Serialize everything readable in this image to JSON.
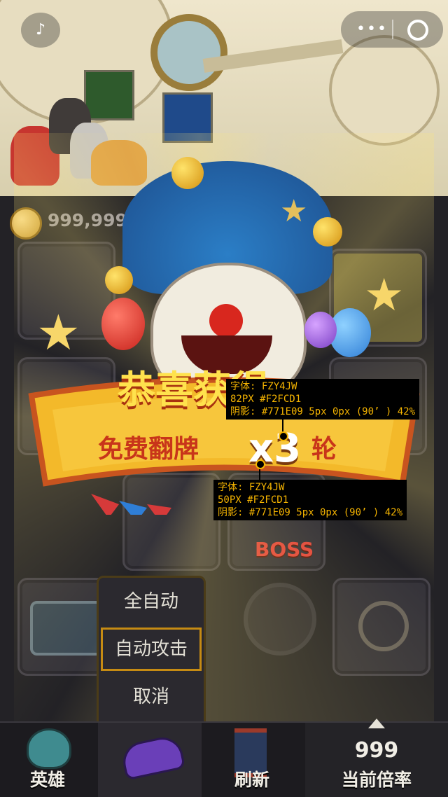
{
  "top_bar": {
    "mute_icon": "speaker-mute-icon",
    "menu_icon": "more-icon",
    "close_icon": "target-icon"
  },
  "hud": {
    "coins": "999,999,999"
  },
  "banner": {
    "title": "恭喜获得",
    "subtitle": "免费翻牌",
    "multiplier": "x3",
    "unit": "轮"
  },
  "annotations": {
    "a1": [
      "字体: FZY4JW",
      "82PX #F2FCD1",
      "阴影: #771E09 5px 0px (90’ ) 42%"
    ],
    "a2": [
      "字体: FZY4JW",
      "50PX #F2FCD1",
      "阴影: #771E09 5px 0px (90’ ) 42%"
    ]
  },
  "tiles": {
    "boss_label": "BOSS"
  },
  "auto_menu": {
    "items": [
      "全自动",
      "自动攻击",
      "取消"
    ]
  },
  "nav": {
    "hero": "英雄",
    "refresh": "刷新",
    "multiplier_value": "999",
    "multiplier_label": "当前倍率"
  },
  "colors": {
    "title_text": "#F2FCD1",
    "title_shadow": "#771E09",
    "banner": "#f3b92a",
    "annot_text": "#f5b400"
  }
}
